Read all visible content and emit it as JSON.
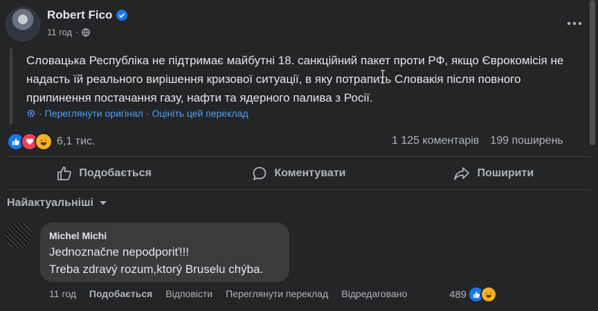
{
  "post": {
    "author": "Robert Fico",
    "time": "11 год",
    "text": "Словацька Республіка не підтримає майбутні 18. санкційний пакет проти РФ, якщо Єврокомісія не надасть їй реального вирішення кризової ситуації, в яку потрапить Словакія після повного припинення постачання газу, нафти та ядерного палива з Росії.",
    "see_original": "Переглянути оригінал",
    "rate_translation": "Оцініть цей переклад",
    "reaction_count": "6,1 тис.",
    "comments_count": "1 125 коментарів",
    "shares_count": "199 поширень"
  },
  "actions": {
    "like": "Подобається",
    "comment": "Коментувати",
    "share": "Поширити"
  },
  "sort_label": "Найактуальніші",
  "comment": {
    "author": "Michel Michi",
    "line1": "Jednoznačne nepodporiť!!!",
    "line2": "Treba zdravý rozum,ktorý Bruselu chýba.",
    "time": "11 год",
    "like": "Подобається",
    "reply": "Відповісти",
    "see_translation": "Переглянути переклад",
    "edited": "Відредаговано",
    "reaction_count": "489"
  },
  "colors": {
    "background": "#242526",
    "bubble": "#3a3b3c",
    "text_primary": "#e4e6eb",
    "text_secondary": "#b0b3b8",
    "link": "#4e9ef5",
    "like_blue": "#1877f2",
    "love_red": "#f33e58",
    "haha_yellow": "#f7b125"
  },
  "icons": [
    "verified-icon",
    "globe-icon",
    "more-icon",
    "gear-icon",
    "like-icon",
    "love-icon",
    "haha-icon",
    "thumbs-up-icon",
    "comment-icon",
    "share-icon",
    "chevron-down-icon"
  ]
}
